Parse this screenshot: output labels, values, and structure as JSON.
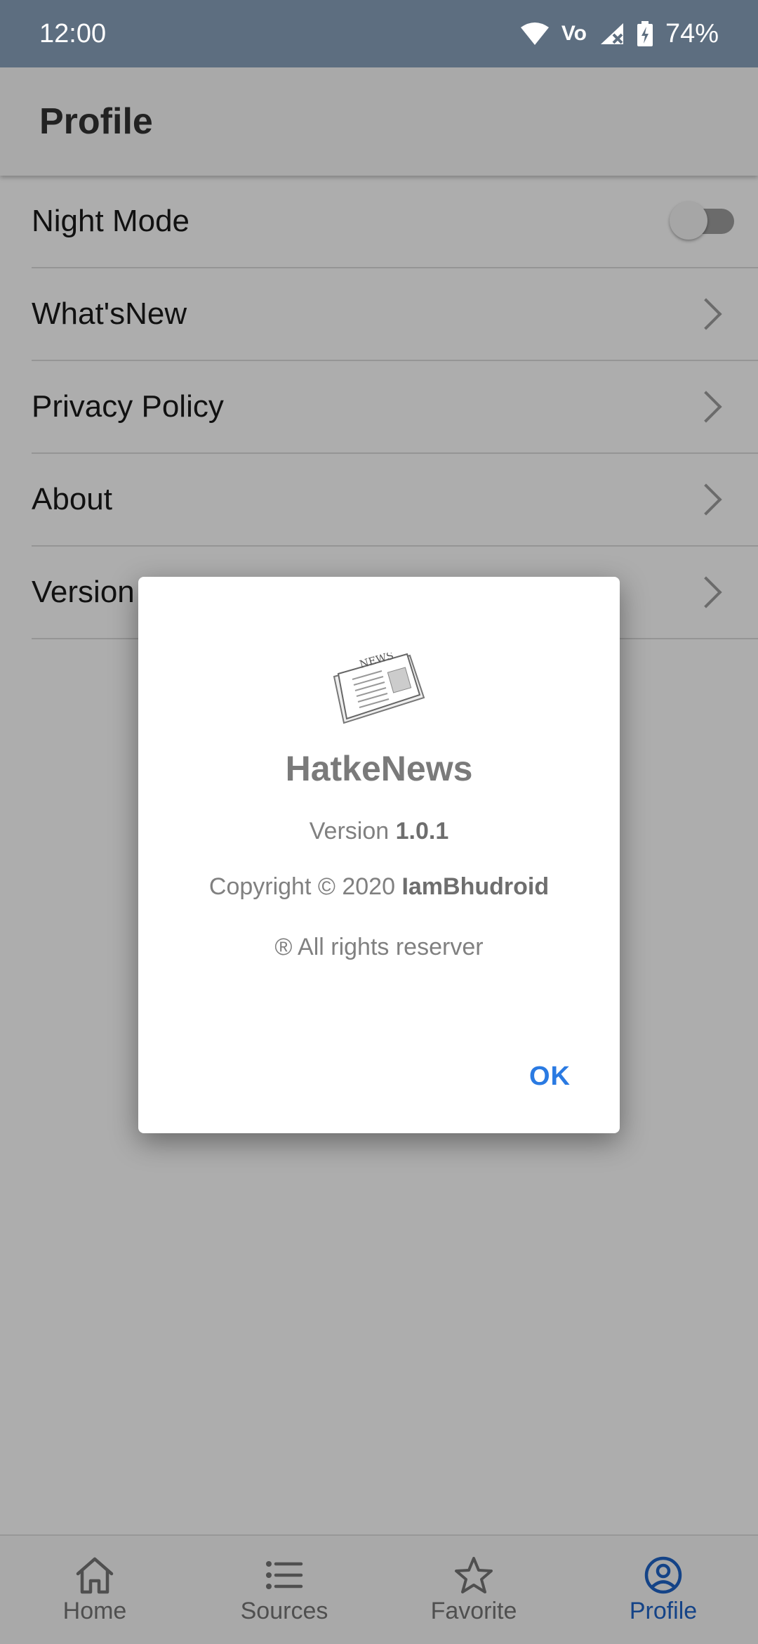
{
  "status_bar": {
    "time": "12:00",
    "battery": "74%",
    "volte": "Vo"
  },
  "app_bar": {
    "title": "Profile"
  },
  "settings": {
    "night_mode": "Night Mode",
    "whats_new": "What'sNew",
    "privacy_policy": "Privacy Policy",
    "about": "About",
    "version": "Version"
  },
  "dialog": {
    "title": "HatkeNews",
    "version_label": "Version",
    "version_value": "1.0.1",
    "copyright_label": "Copyright © 2020",
    "copyright_owner": "IamBhudroid",
    "rights": "® All rights reserver",
    "ok": "OK"
  },
  "bottom_nav": {
    "items": [
      {
        "label": "Home",
        "icon": "home-icon"
      },
      {
        "label": "Sources",
        "icon": "list-icon"
      },
      {
        "label": "Favorite",
        "icon": "star-icon"
      },
      {
        "label": "Profile",
        "icon": "account-circle-icon"
      }
    ],
    "active_index": 3
  },
  "colors": {
    "status_bar": "#5d6e80",
    "accent": "#1e63c8",
    "dialog_button": "#2a7ae2"
  }
}
